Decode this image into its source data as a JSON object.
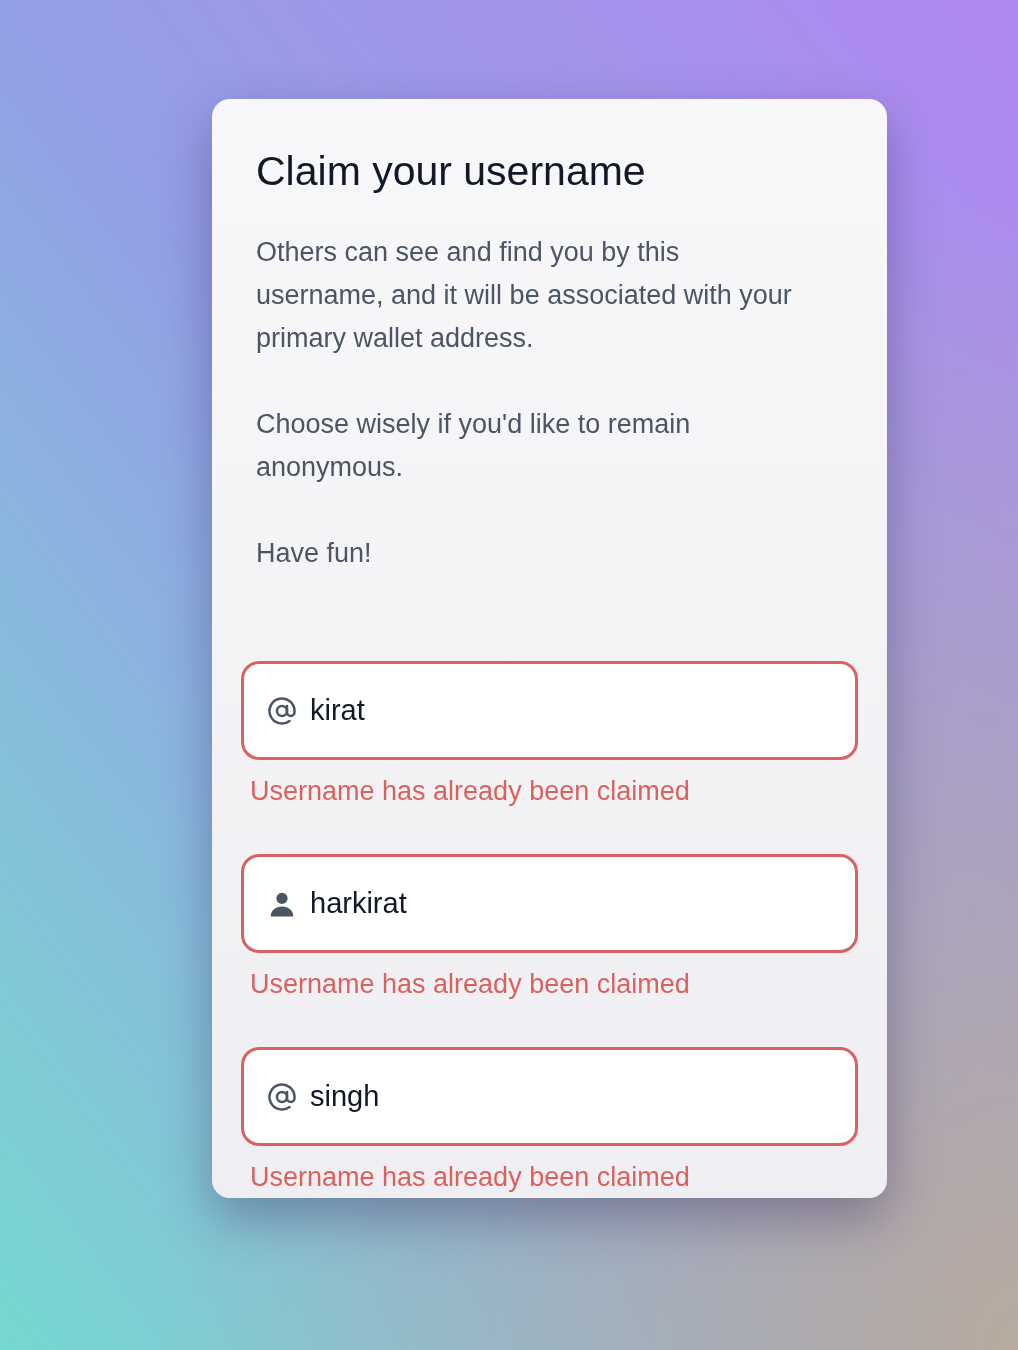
{
  "card": {
    "title": "Claim your username",
    "paragraphs": [
      "Others can see and find you by this username, and it will be associated with your primary wallet address.",
      "Choose wisely if you'd like to remain anonymous.",
      "Have fun!"
    ],
    "fields": [
      {
        "kind": "at",
        "value": "kirat",
        "invalid": true,
        "error": "Username has already been claimed"
      },
      {
        "kind": "person",
        "value": "harkirat",
        "invalid": true,
        "error": "Username has already been claimed"
      },
      {
        "kind": "at",
        "value": "singh",
        "invalid": true,
        "error": "Username has already been claimed"
      }
    ]
  }
}
